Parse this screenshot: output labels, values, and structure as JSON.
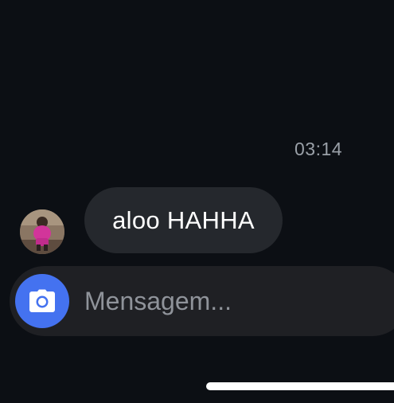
{
  "chat": {
    "timestamp": "03:14",
    "messages": [
      {
        "text": "aloo HAHHA",
        "direction": "incoming"
      }
    ]
  },
  "composer": {
    "placeholder": "Mensagem...",
    "value": "",
    "camera_icon": "camera-icon",
    "accent_color": "#4472f0"
  },
  "colors": {
    "background": "#0c0f14",
    "bubble": "#25282d",
    "composer": "#1f2024"
  }
}
